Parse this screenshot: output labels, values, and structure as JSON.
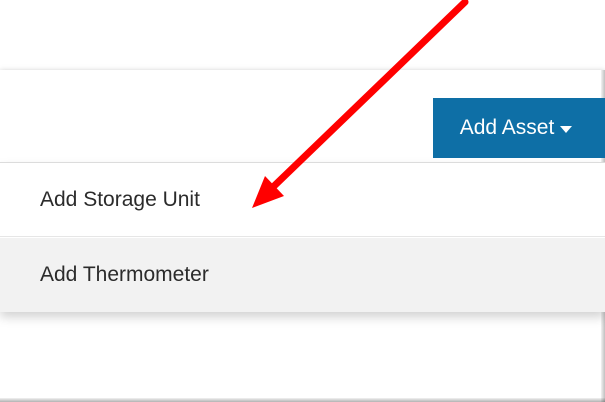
{
  "toolbar": {
    "add_asset_label": "Add Asset",
    "add_asset_color": "#0e6fa6",
    "caret_icon": "caret-down-icon"
  },
  "menu": {
    "items": [
      {
        "label": "Add Storage Unit"
      },
      {
        "label": "Add Thermometer"
      }
    ]
  },
  "annotation": {
    "arrow_color": "#ff0000"
  }
}
